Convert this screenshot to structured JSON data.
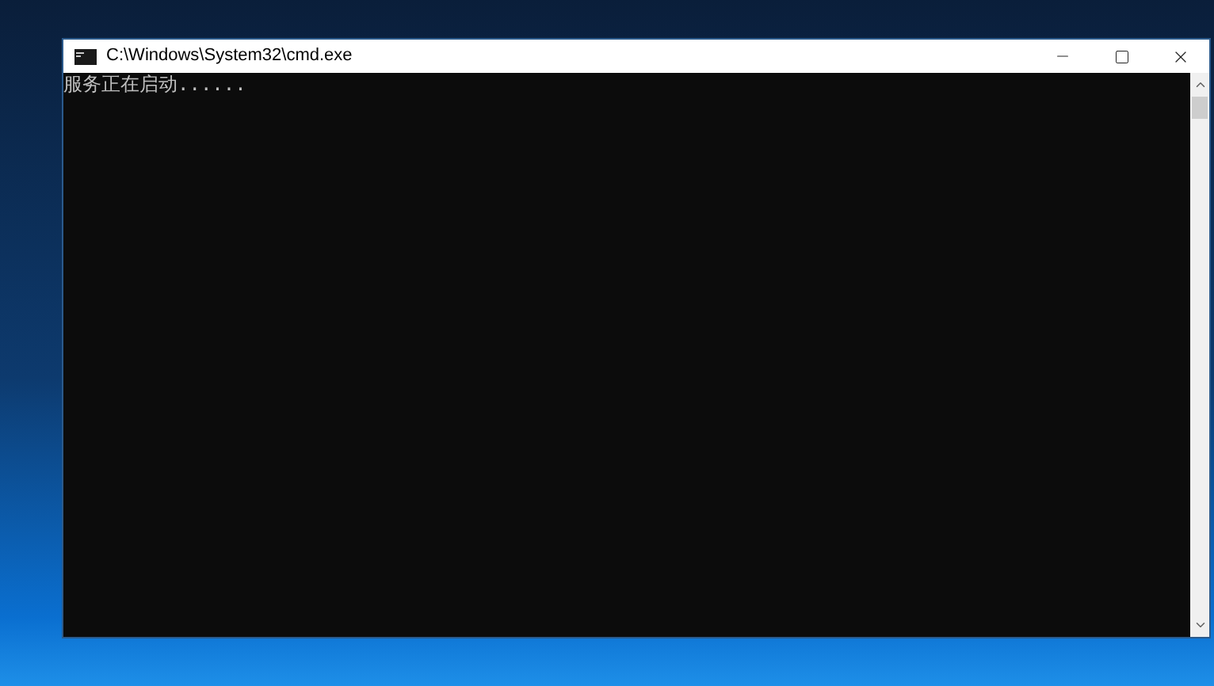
{
  "window": {
    "title": "C:\\Windows\\System32\\cmd.exe"
  },
  "console": {
    "lines": [
      "服务正在启动......"
    ]
  }
}
